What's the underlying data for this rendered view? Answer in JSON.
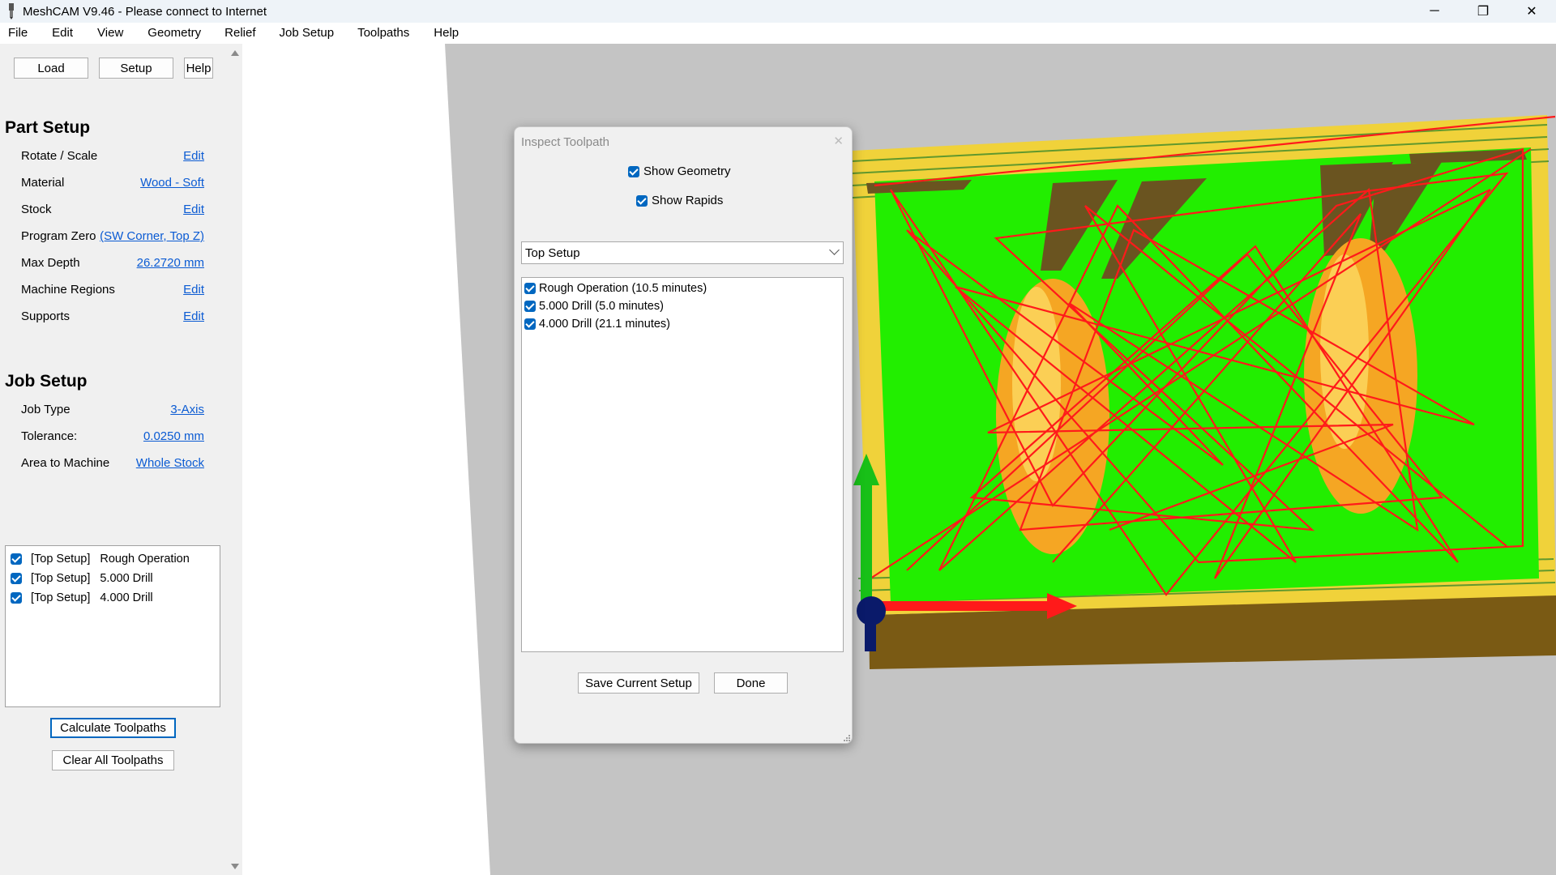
{
  "window": {
    "title": "MeshCAM V9.46 - Please connect to Internet",
    "controls": [
      "─",
      "❐",
      "✕"
    ]
  },
  "menu": [
    "File",
    "Edit",
    "View",
    "Geometry",
    "Relief",
    "Job Setup",
    "Toolpaths",
    "Help"
  ],
  "top_buttons": {
    "load": "Load",
    "setup": "Setup",
    "help": "Help"
  },
  "part_setup": {
    "title": "Part Setup",
    "rows": [
      {
        "label": "Rotate / Scale",
        "value": "Edit"
      },
      {
        "label": "Material",
        "value": "Wood - Soft"
      },
      {
        "label": "Stock",
        "value": "Edit"
      },
      {
        "label": "Program Zero",
        "value": "(SW Corner, Top Z)"
      },
      {
        "label": "Max Depth",
        "value": "26.2720 mm"
      },
      {
        "label": "Machine Regions",
        "value": "Edit"
      },
      {
        "label": "Supports",
        "value": "Edit"
      }
    ]
  },
  "job_setup": {
    "title": "Job Setup",
    "rows": [
      {
        "label": "Job Type",
        "value": "3-Axis"
      },
      {
        "label": "Tolerance:",
        "value": "0.0250 mm"
      },
      {
        "label": "Area to Machine",
        "value": "Whole Stock"
      }
    ]
  },
  "operations": [
    {
      "setup": "[Top Setup]",
      "name": "Rough Operation",
      "checked": true
    },
    {
      "setup": "[Top Setup]",
      "name": "5.000 Drill",
      "checked": true
    },
    {
      "setup": "[Top Setup]",
      "name": "4.000 Drill",
      "checked": true
    }
  ],
  "actions": {
    "calculate": "Calculate Toolpaths",
    "clear": "Clear All Toolpaths"
  },
  "dialog": {
    "title": "Inspect Toolpath",
    "close": "✕",
    "show_geometry": {
      "label": "Show Geometry",
      "checked": true
    },
    "show_rapids": {
      "label": "Show Rapids",
      "checked": true
    },
    "setup_selected": "Top Setup",
    "toolpaths": [
      {
        "label": "Rough Operation (10.5 minutes)",
        "checked": true
      },
      {
        "label": "5.000 Drill (5.0 minutes)",
        "checked": true
      },
      {
        "label": "4.000 Drill (21.1 minutes)",
        "checked": true
      }
    ],
    "save_button": "Save Current Setup",
    "done_button": "Done"
  },
  "colors": {
    "link": "#0b5bd3",
    "accent_checkbox": "#0067c0",
    "toolpath_green": "#22ee00",
    "rapid_red": "#ff1a1a",
    "stock_brown": "#7a5a14",
    "geometry_orange": "#f5a623"
  }
}
